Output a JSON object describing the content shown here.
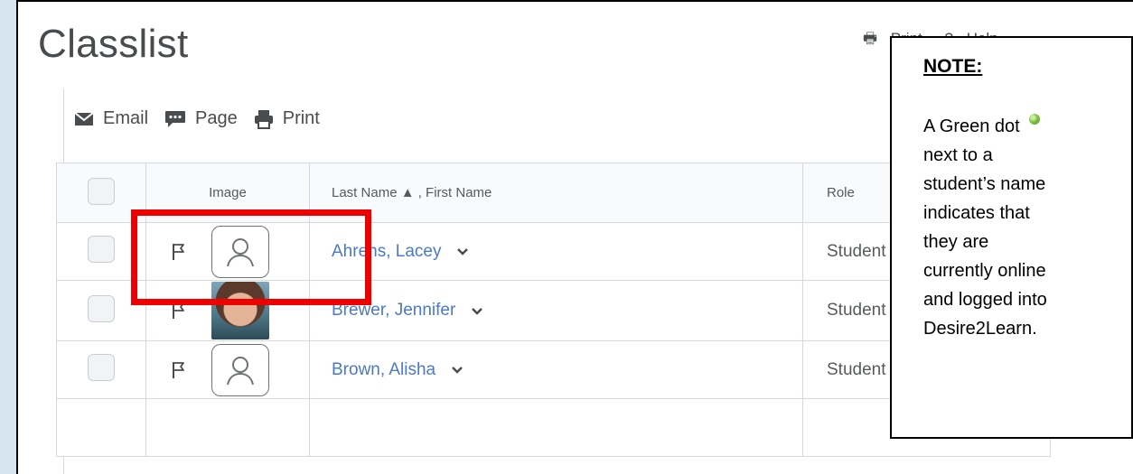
{
  "page": {
    "title": "Classlist"
  },
  "top_actions": {
    "print_label": "Print",
    "help_label": "Help"
  },
  "toolbar": {
    "email_label": "Email",
    "page_label": "Page",
    "print_label": "Print"
  },
  "table": {
    "headers": {
      "image": "Image",
      "name": "Last Name ▲ , First Name",
      "role": "Role"
    },
    "rows": [
      {
        "name": "Ahrens, Lacey",
        "role": "Student",
        "image": "default-avatar-icon"
      },
      {
        "name": "Brewer, Jennifer",
        "role": "Student",
        "image": "profile-photo"
      },
      {
        "name": "Brown, Alisha",
        "role": "Student",
        "image": "default-avatar-icon"
      }
    ]
  },
  "note": {
    "heading": "NOTE:",
    "line1": "A Green dot",
    "line2": "next to a",
    "line3": "student’s name",
    "line4": "indicates that",
    "line5": "they are",
    "line6": "currently online",
    "line7": "and logged into",
    "line8": "Desire2Learn."
  },
  "colors": {
    "link": "#4a79c6",
    "highlight": "#ee0000",
    "online_dot": "#7cc043"
  }
}
